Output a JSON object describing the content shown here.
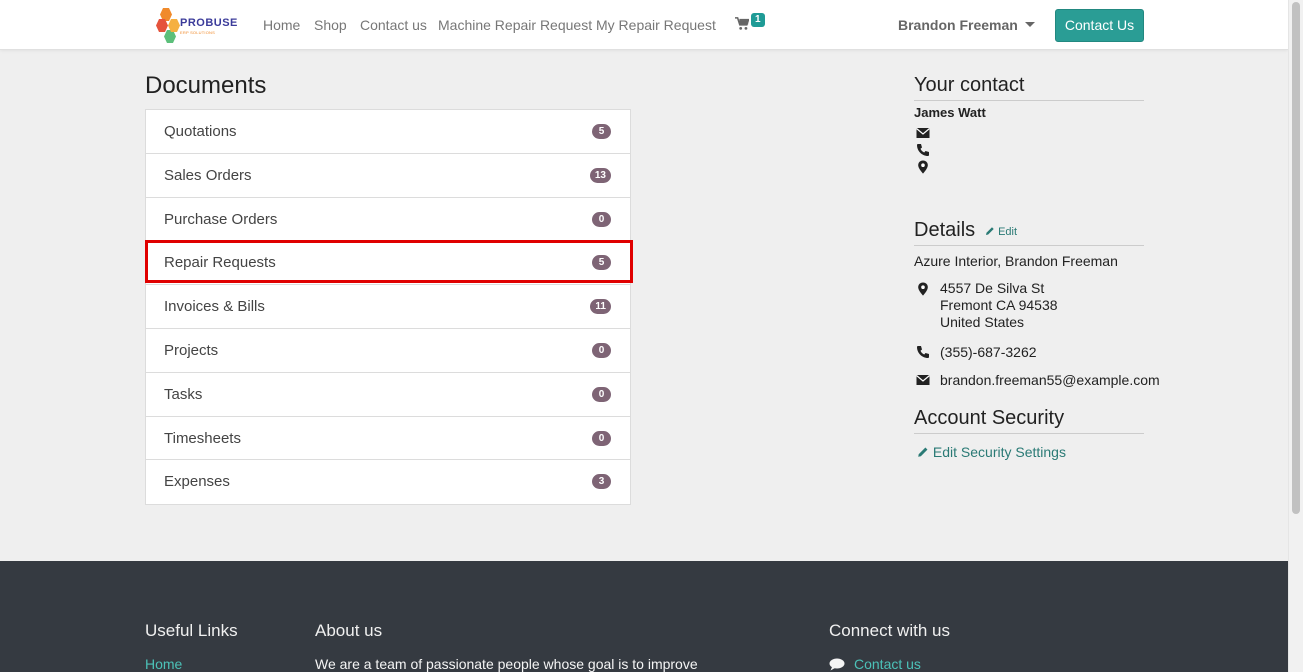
{
  "header": {
    "logo_text": "PROBUSE",
    "logo_sub": "ERP SOLUTIONS",
    "nav": [
      "Home",
      "Shop",
      "Contact us",
      "Machine Repair Request",
      "My Repair Request"
    ],
    "cart_count": "1",
    "user_name": "Brandon Freeman",
    "contact_button": "Contact Us"
  },
  "documents": {
    "title": "Documents",
    "items": [
      {
        "label": "Quotations",
        "count": "5"
      },
      {
        "label": "Sales Orders",
        "count": "13"
      },
      {
        "label": "Purchase Orders",
        "count": "0"
      },
      {
        "label": "Repair Requests",
        "count": "5"
      },
      {
        "label": "Invoices & Bills",
        "count": "11"
      },
      {
        "label": "Projects",
        "count": "0"
      },
      {
        "label": "Tasks",
        "count": "0"
      },
      {
        "label": "Timesheets",
        "count": "0"
      },
      {
        "label": "Expenses",
        "count": "3"
      }
    ]
  },
  "contact": {
    "heading": "Your contact",
    "name": "James Watt"
  },
  "details": {
    "heading": "Details",
    "edit_label": "Edit",
    "company": "Azure Interior, Brandon Freeman",
    "address_line1": "4557 De Silva St",
    "address_line2": "Fremont CA 94538",
    "address_line3": "United States",
    "phone": "(355)-687-3262",
    "email": "brandon.freeman55@example.com"
  },
  "security": {
    "heading": "Account Security",
    "link": "Edit Security Settings"
  },
  "footer": {
    "useful_links_heading": "Useful Links",
    "useful_links_first": "Home",
    "about_heading": "About us",
    "about_text": "We are a team of passionate people whose goal is to improve",
    "connect_heading": "Connect with us",
    "connect_link": "Contact us"
  },
  "colors": {
    "accent": "#2a9d95",
    "badge": "#7e6475",
    "highlight": "#e00000",
    "footer_bg": "#353a41"
  }
}
